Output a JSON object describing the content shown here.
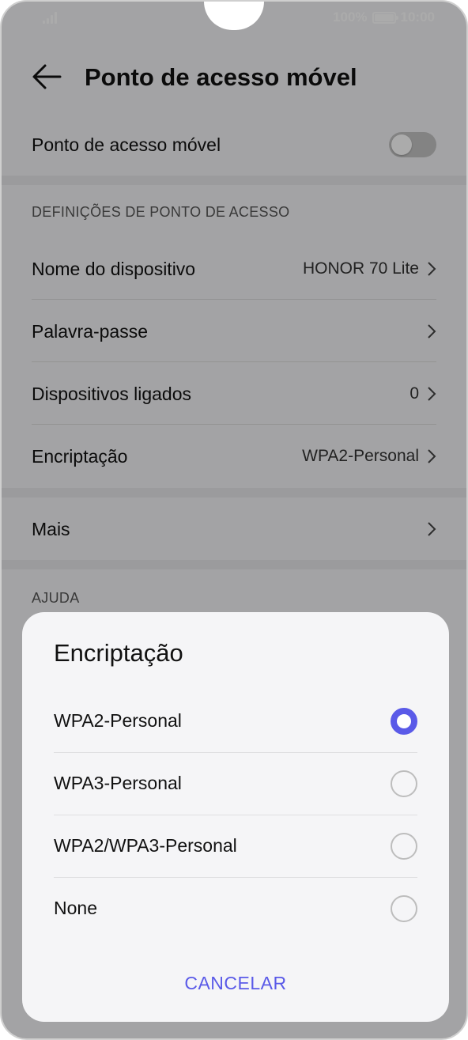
{
  "status_bar": {
    "battery_percent": "100%",
    "time": "10:00",
    "battery_level": 1.0
  },
  "header": {
    "title": "Ponto de acesso móvel"
  },
  "hotspot_toggle": {
    "label": "Ponto de acesso móvel",
    "enabled": false
  },
  "settings_section": {
    "header": "DEFINIÇÕES DE PONTO DE ACESSO",
    "items": [
      {
        "label": "Nome do dispositivo",
        "value": "HONOR 70 Lite"
      },
      {
        "label": "Palavra-passe",
        "value": ""
      },
      {
        "label": "Dispositivos ligados",
        "value": "0"
      },
      {
        "label": "Encriptação",
        "value": "WPA2-Personal"
      }
    ]
  },
  "more": {
    "label": "Mais"
  },
  "help_section": {
    "header": "AJUDA"
  },
  "dialog": {
    "title": "Encriptação",
    "options": [
      {
        "label": "WPA2-Personal",
        "selected": true
      },
      {
        "label": "WPA3-Personal",
        "selected": false
      },
      {
        "label": "WPA2/WPA3-Personal",
        "selected": false
      },
      {
        "label": "None",
        "selected": false
      }
    ],
    "cancel_label": "CANCELAR",
    "accent_color": "#5a5ae8"
  }
}
